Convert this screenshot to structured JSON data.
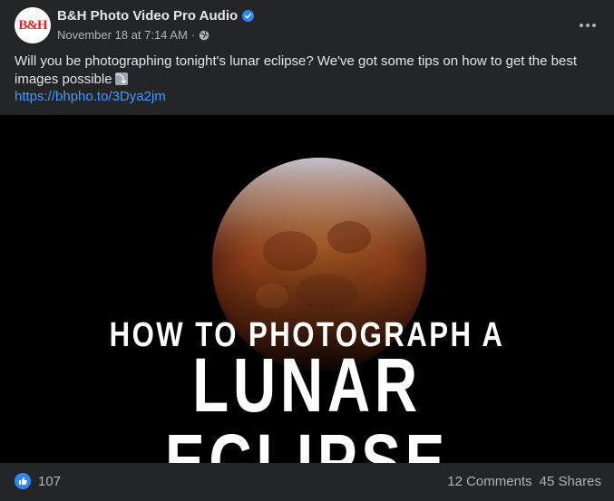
{
  "page": {
    "name": "B&H Photo Video Pro Audio",
    "avatar_text": "B&H",
    "verified": true,
    "timestamp": "November 18 at 7:14 AM",
    "separator": "·",
    "audience_icon": "globe-icon"
  },
  "post": {
    "text": "Will you be photographing tonight's lunar eclipse? We've got some tips on how to get the best images possible",
    "emoji": "⤵",
    "link": "https://bhpho.to/3Dya2jm"
  },
  "media": {
    "headline_small": "HOW TO PHOTOGRAPH A",
    "headline_large": "LUNAR ECLIPSE"
  },
  "engagement": {
    "reaction_icon": "like-icon",
    "reaction_count": "107",
    "comments": "12 Comments",
    "shares": "45 Shares"
  },
  "colors": {
    "background": "#242526",
    "link": "#4599ff",
    "brand_red": "#e2231a",
    "like_blue": "#2d88ff"
  }
}
